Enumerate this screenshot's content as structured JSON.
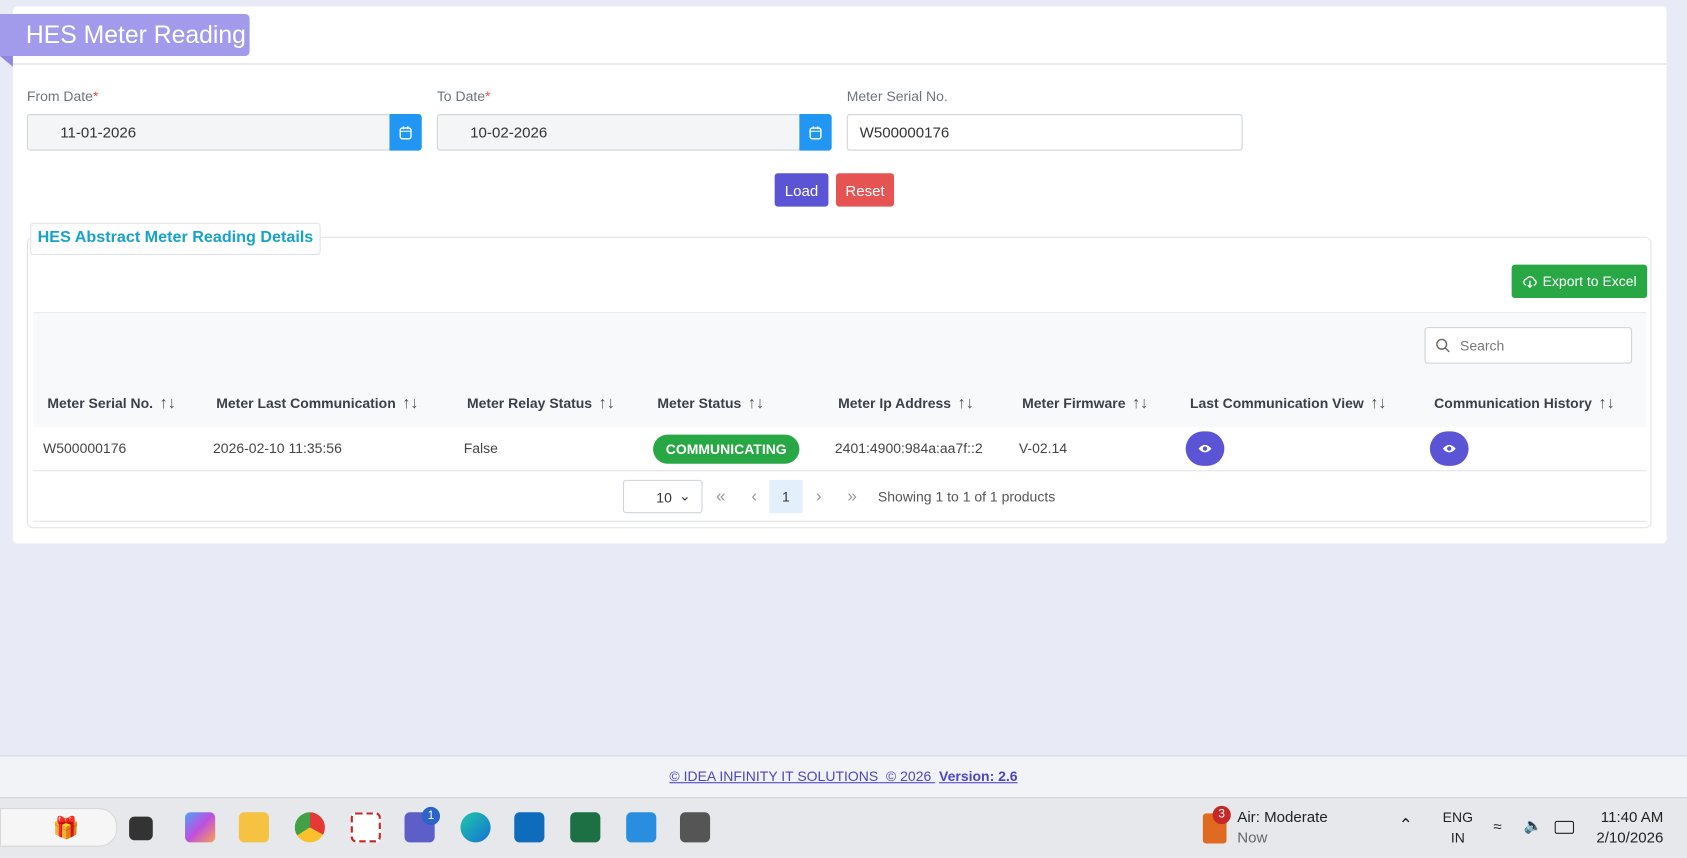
{
  "page": {
    "title": "HES Meter Reading"
  },
  "filters": {
    "from_date_label": "From Date",
    "to_date_label": "To Date",
    "required_mark": "*",
    "from_date": "11-01-2026",
    "to_date": "10-02-2026",
    "meter_serial_label": "Meter Serial No.",
    "meter_serial": "W500000176",
    "load": "Load",
    "reset": "Reset"
  },
  "details": {
    "legend": "HES Abstract Meter Reading Details",
    "export": "Export to Excel",
    "search_placeholder": "Search",
    "columns": [
      "Meter Serial No.",
      "Meter Last Communication",
      "Meter Relay Status",
      "Meter Status",
      "Meter Ip Address",
      "Meter Firmware",
      "Last Communication View",
      "Communication History"
    ],
    "sort_glyph": "↑↓",
    "rows": [
      {
        "serial": "W500000176",
        "last_comm": "2026-02-10 11:35:56",
        "relay": "False",
        "status": "COMMUNICATING",
        "ip": "2401:4900:984a:aa7f::2",
        "firmware": "V-02.14"
      }
    ],
    "pagination": {
      "page_size": "10",
      "first": "«",
      "prev": "‹",
      "current": "1",
      "next": "›",
      "last": "»",
      "summary": "Showing 1 to 1 of 1 products"
    }
  },
  "footer": {
    "copyright": "© IDEA INFINITY IT SOLUTIONS  © 2026 ",
    "version": "Version: 2.6"
  },
  "taskbar": {
    "weather_badge": "3",
    "weather_title": "Air: Moderate",
    "weather_sub": "Now",
    "lang1": "ENG",
    "lang2": "IN",
    "time": "11:40 AM",
    "date": "2/10/2026",
    "teams_badge": "1"
  },
  "colors": {
    "accent": "#5b55d6",
    "tab": "#a29bec",
    "status_green": "#28a745",
    "reset": "#e55353",
    "calendar": "#2196f3"
  }
}
